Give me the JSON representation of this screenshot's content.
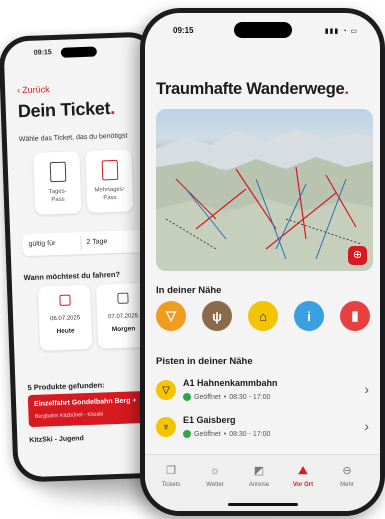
{
  "back_phone": {
    "status_time": "09:15",
    "back_label": "Zurück",
    "title": "Dein Ticket",
    "title_dot": ".",
    "subtitle": "Wähle das Ticket, das du benötigst",
    "passes": [
      {
        "label": "Tages-\nPass"
      },
      {
        "label": "Mehrtages-\nPass"
      }
    ],
    "valid_label": "gültig für",
    "valid_value": "2 Tage",
    "when_question": "Wann möchtest du fahren?",
    "dates": [
      {
        "date": "06.07.2025",
        "weekday": "Heute"
      },
      {
        "date": "07.07.2025",
        "weekday": "Morgen"
      }
    ],
    "found_label": "5 Produkte gefunden:",
    "product1_name": "Einzelfahrt Gondelbahn Berg +",
    "product1_sub": "Bergbahn Kitzbühel - Kitzski",
    "product2_name": "KitzSki - Jugend"
  },
  "front_phone": {
    "status_time": "09:15",
    "title": "Traumhafte Wanderwege",
    "title_dot": ".",
    "nearby_label": "In deiner Nähe",
    "quick_icons": [
      {
        "name": "gondola-icon",
        "color": "#f29c1f"
      },
      {
        "name": "restaurant-icon",
        "color": "#8b6a4c"
      },
      {
        "name": "hut-icon",
        "color": "#f5c400"
      },
      {
        "name": "info-icon",
        "color": "#3aa0e0"
      },
      {
        "name": "bookmark-icon",
        "color": "#e84040"
      }
    ],
    "slopes_label": "Pisten in deiner Nähe",
    "slopes": [
      {
        "code": "A1",
        "name": "Hahnenkammbahn",
        "status": "Geöffnet",
        "hours": "08:30 - 17:00"
      },
      {
        "code": "E1",
        "name": "Gaisberg",
        "status": "Geöffnet",
        "hours": "08:30 - 17:00"
      }
    ],
    "tabs": [
      {
        "label": "Tickets",
        "icon": "tickets-icon"
      },
      {
        "label": "Wetter",
        "icon": "weather-icon"
      },
      {
        "label": "Anreise",
        "icon": "travel-icon"
      },
      {
        "label": "Vor Ort",
        "icon": "local-icon",
        "active": true
      },
      {
        "label": "Mehr",
        "icon": "more-icon"
      }
    ],
    "accent": "#d71920"
  }
}
